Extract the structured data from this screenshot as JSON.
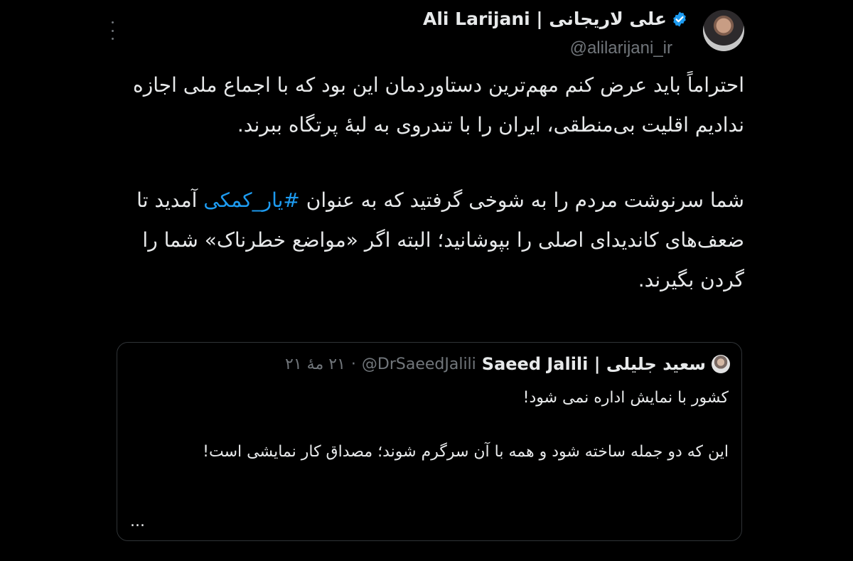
{
  "tweet": {
    "author": {
      "display_name": "علی لاریجانی | Ali Larijani",
      "handle": "@alilarijani_ir",
      "verified": true,
      "verified_icon": "verified-badge-icon",
      "verified_color": "#1d9bf0"
    },
    "more_icon": "more-options-icon",
    "paragraphs": [
      "احتراماً باید عرض کنم مهم‌ترین دستاوردمان این بود که با اجماع ملی اجازه ندادیم اقلیت بی‌منطقی، ایران را با تندروی به لبهٔ پرتگاه ببرند."
    ],
    "paragraph2": {
      "before": "شما سرنوشت مردم را به شوخی گرفتید که به عنوان ",
      "hashtag": "#یار_کمکی",
      "after": " آمدید تا ضعف‌های کاندیدای اصلی را بپوشانید؛ البته اگر «مواضع خطرناک» شما را گردن بگیرند."
    },
    "hashtag_color": "#1d9bf0"
  },
  "quote": {
    "author": {
      "display_name": "سعید جلیلی | Saeed Jalili",
      "handle": "@DrSaeedJalili",
      "separator": "·",
      "date": "۲۱ مهٔ ۲۱"
    },
    "paragraphs": [
      "کشور با نمایش اداره نمی شود!",
      "این که دو جمله ساخته شود و همه با آن سرگرم شوند؛ مصداق کار نمایشی است!"
    ],
    "ellipsis": "..."
  },
  "colors": {
    "background": "#000000",
    "text": "#e7e9ea",
    "secondary": "#71767b",
    "border": "#2f3336"
  }
}
